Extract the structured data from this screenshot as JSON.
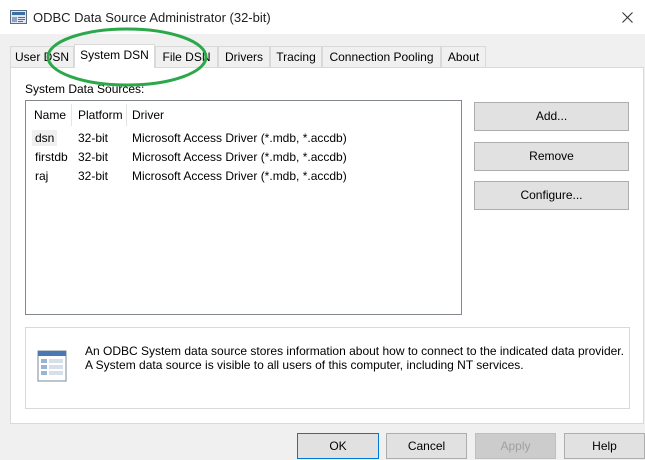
{
  "window": {
    "title": "ODBC Data Source Administrator (32-bit)",
    "close_icon": "close-icon",
    "app_icon": "odbc-app-icon"
  },
  "tabs": [
    {
      "label": "User DSN",
      "active": false
    },
    {
      "label": "System DSN",
      "active": true
    },
    {
      "label": "File DSN",
      "active": false
    },
    {
      "label": "Drivers",
      "active": false
    },
    {
      "label": "Tracing",
      "active": false
    },
    {
      "label": "Connection Pooling",
      "active": false
    },
    {
      "label": "About",
      "active": false
    }
  ],
  "system_dsn": {
    "section_label": "System Data Sources:",
    "columns": [
      "Name",
      "Platform",
      "Driver"
    ],
    "rows": [
      {
        "name": "dsn",
        "platform": "32-bit",
        "driver": "Microsoft Access Driver (*.mdb, *.accdb)"
      },
      {
        "name": "firstdb",
        "platform": "32-bit",
        "driver": "Microsoft Access Driver (*.mdb, *.accdb)"
      },
      {
        "name": "raj",
        "platform": "32-bit",
        "driver": "Microsoft Access Driver (*.mdb, *.accdb)"
      }
    ],
    "buttons": {
      "add": "Add...",
      "remove": "Remove",
      "configure": "Configure..."
    },
    "info": {
      "line1": "An ODBC System data source stores information about how to connect to the indicated data provider.",
      "line2": "A System data source is visible to all users of this computer, including NT services.",
      "icon": "data-source-icon"
    }
  },
  "footer": {
    "ok": "OK",
    "cancel": "Cancel",
    "apply": "Apply",
    "help": "Help"
  },
  "colors": {
    "annotation": "#2aa84a",
    "selection": "#f0f0f0",
    "button_face": "#e1e1e1"
  }
}
